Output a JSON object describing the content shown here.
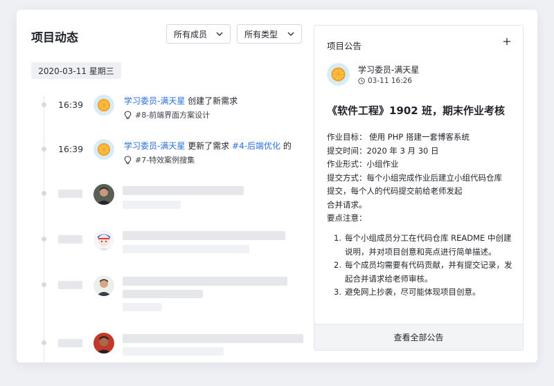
{
  "header": {
    "title": "项目动态",
    "filters": [
      {
        "label": "所有成员"
      },
      {
        "label": "所有类型"
      }
    ]
  },
  "timeline": {
    "date_label": "2020-03-11 星期三",
    "activities": [
      {
        "time": "16:39",
        "user": "学习委员-满天星",
        "action": "创建了新需求",
        "target": "",
        "suffix": "",
        "detail": "#8-前端界面方案设计"
      },
      {
        "time": "16:39",
        "user": "学习委员-满天星",
        "action": "更新了需求",
        "target": "#4-后端优化",
        "suffix": "的",
        "detail": "#7-特效案例搜集"
      }
    ]
  },
  "notice": {
    "header": "项目公告",
    "add_icon": "plus-icon",
    "author": "学习委员-满天星",
    "time": "03-11 16:26",
    "title": "《软件工程》1902 班，期末作业考核",
    "lines": [
      "作业目标： 使用 PHP 搭建一套博客系统",
      "提交时间：2020 年 3 月 30 日",
      "作业形式：小组作业",
      "提交方式：每个小组完成作业后建立小组代码仓库",
      "提交，每个人的代码提交前给老师发起",
      "合并请求。",
      "要点注意："
    ],
    "points": [
      {
        "num": "1.",
        "text": "每个小组成员分工在代码仓库 README 中创建说明，并对项目创意和亮点进行简单描述。"
      },
      {
        "num": "2.",
        "text": "每个成员均需要有代码贡献，并有提交记录，发起合并请求给老师审核。"
      },
      {
        "num": "3.",
        "text": "避免网上抄袭，尽可能体现项目创意。"
      }
    ],
    "footer": "查看全部公告"
  },
  "colors": {
    "link": "#2b6fe0",
    "skeleton": "#e5e7eb",
    "background": "#eef0f4"
  }
}
